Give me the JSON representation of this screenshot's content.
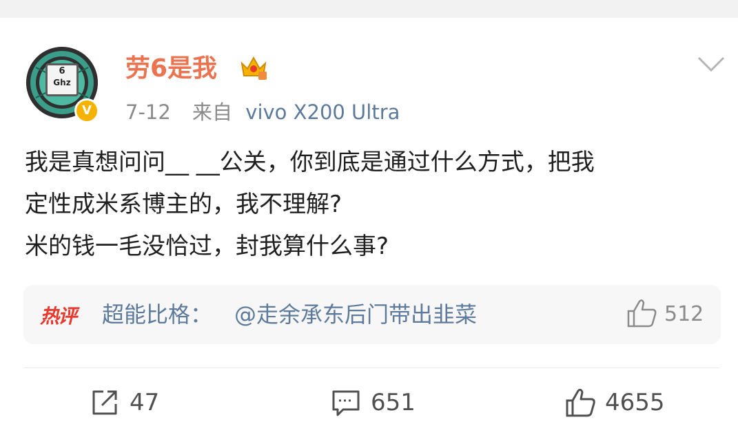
{
  "post": {
    "username": "劳6是我",
    "avatar": {
      "line1": "6",
      "line2": "Ghz"
    },
    "verified_badge": "V",
    "date": "7-12",
    "from_label": "来自",
    "device": "vivo X200 Ultra",
    "text": "我是真想问问__ __公关，你到底是通过什么方式，把我\n定性成米系博主的，我不理解?\n米的钱一毛没恰过，封我算什么事?"
  },
  "hot_comment": {
    "badge": "热评",
    "commenter": "超能比格：",
    "text": "@走余承东后门带出韭菜",
    "likes": "512"
  },
  "actions": {
    "reposts": "47",
    "comments": "651",
    "likes": "4655"
  },
  "icons": {
    "crown": "crown-icon",
    "chevron": "chevron-down-icon",
    "repost": "repost-icon",
    "comment": "comment-icon",
    "like": "thumbs-up-icon"
  },
  "colors": {
    "username": "#eb7350",
    "link": "#5d7a9c",
    "hot_badge": "#e8392f",
    "verified": "#f5b300"
  }
}
